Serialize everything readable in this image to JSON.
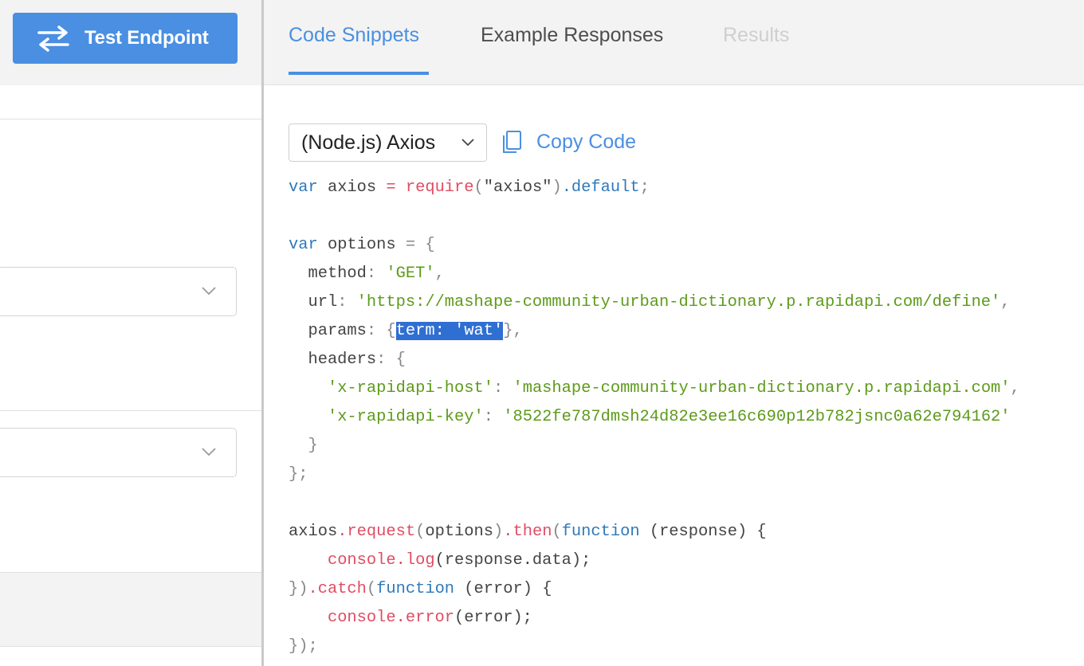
{
  "left_panel": {
    "test_button_label": "Test Endpoint"
  },
  "tabs": [
    {
      "label": "Code Snippets",
      "state": "active"
    },
    {
      "label": "Example Responses",
      "state": "normal"
    },
    {
      "label": "Results",
      "state": "disabled"
    }
  ],
  "snippet": {
    "language_selected": "(Node.js) Axios",
    "copy_label": "Copy Code",
    "code": {
      "l1_var": "var",
      "l1_axios": " axios ",
      "l1_eq": "=",
      "l1_require": " require",
      "l1_lp": "(",
      "l1_str": "\"axios\"",
      "l1_rp": ")",
      "l1_default": ".default",
      "l1_semi": ";",
      "l3_var": "var",
      "l3_options": " options ",
      "l3_rest": "= {",
      "l4_key": "  method",
      "l4_colon": ": ",
      "l4_val": "'GET'",
      "l4_comma": ",",
      "l5_key": "  url",
      "l5_colon": ": ",
      "l5_val": "'https://mashape-community-urban-dictionary.p.rapidapi.com/define'",
      "l5_comma": ",",
      "l6_key": "  params",
      "l6_colon": ": ",
      "l6_brace": "{",
      "l6_sel_key": "term",
      "l6_sel_colon": ": ",
      "l6_sel_val": "'wat'",
      "l6_end": "},",
      "l7_key": "  headers",
      "l7_colon": ": ",
      "l7_brace": "{",
      "l8_indent": "    ",
      "l8_key": "'x-rapidapi-host'",
      "l8_colon": ": ",
      "l8_val": "'mashape-community-urban-dictionary.p.rapidapi.com'",
      "l8_comma": ",",
      "l9_indent": "    ",
      "l9_key": "'x-rapidapi-key'",
      "l9_colon": ": ",
      "l9_val": "'8522fe787dmsh24d82e3ee16c690p12b782jsnc0a62e794162'",
      "l10": "  }",
      "l11": "};",
      "l13_obj": "axios",
      "l13_request": ".request",
      "l13_lp": "(",
      "l13_options": "options",
      "l13_rp": ")",
      "l13_then": ".then",
      "l13_lp2": "(",
      "l13_function": "function",
      "l13_args": " (response) {",
      "l14_indent": "    ",
      "l14_console": "console",
      "l14_log": ".log",
      "l14_args": "(response.data);",
      "l15_close": "})",
      "l15_catch": ".catch",
      "l15_lp": "(",
      "l15_function": "function",
      "l15_args": " (error) {",
      "l16_indent": "    ",
      "l16_console": "console",
      "l16_error": ".error",
      "l16_args": "(error);",
      "l17": "});"
    }
  },
  "colors": {
    "accent": "#4a8fe2",
    "keyword": "#2f79b9",
    "function": "#e04d63",
    "string": "#5d9b1a",
    "selection": "#2f6fd2"
  },
  "icons": {
    "test_button": "swap-arrows-icon",
    "copy": "copy-icon",
    "dropdown": "chevron-down-icon"
  }
}
